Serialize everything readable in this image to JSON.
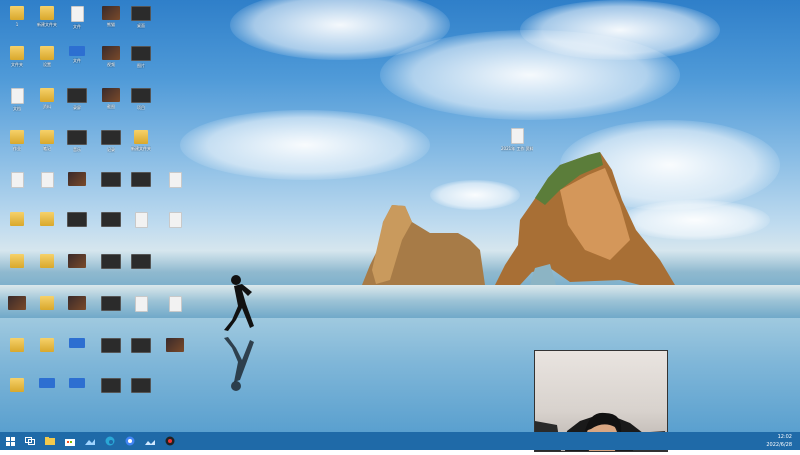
{
  "desktop": {
    "icons": [
      {
        "label": "1",
        "type": "folder"
      },
      {
        "label": "新建文件夹",
        "type": "folder"
      },
      {
        "label": "文件",
        "type": "doc"
      },
      {
        "label": "熊猫",
        "type": "thumb"
      },
      {
        "label": "桌面",
        "type": "dark"
      },
      {
        "label": "文件夹",
        "type": "folder"
      },
      {
        "label": "设置",
        "type": "folder"
      },
      {
        "label": "文件",
        "type": "blue"
      },
      {
        "label": "视频",
        "type": "thumb"
      },
      {
        "label": "图片",
        "type": "dark"
      },
      {
        "label": "文档",
        "type": "doc"
      },
      {
        "label": "资料",
        "type": "folder"
      },
      {
        "label": "录屏",
        "type": "dark"
      },
      {
        "label": "截图",
        "type": "thumb"
      },
      {
        "label": "项目",
        "type": "dark"
      },
      {
        "label": "作业",
        "type": "folder"
      },
      {
        "label": "笔记",
        "type": "folder"
      },
      {
        "label": "音乐",
        "type": "dark"
      },
      {
        "label": "记录",
        "type": "dark"
      },
      {
        "label": "新建文件夹",
        "type": "folder"
      }
    ],
    "single_icon": {
      "label": "2021年 工作 资料"
    }
  },
  "taskbar": {
    "start_icon": "windows-start-icon",
    "apps": [
      {
        "name": "task-view-icon"
      },
      {
        "name": "file-explorer-icon"
      },
      {
        "name": "store-icon"
      },
      {
        "name": "edge-browser-icon"
      },
      {
        "name": "chrome-browser-icon"
      },
      {
        "name": "photos-icon"
      },
      {
        "name": "record-icon"
      }
    ],
    "time": "12:02",
    "date": "2022/6/28"
  }
}
